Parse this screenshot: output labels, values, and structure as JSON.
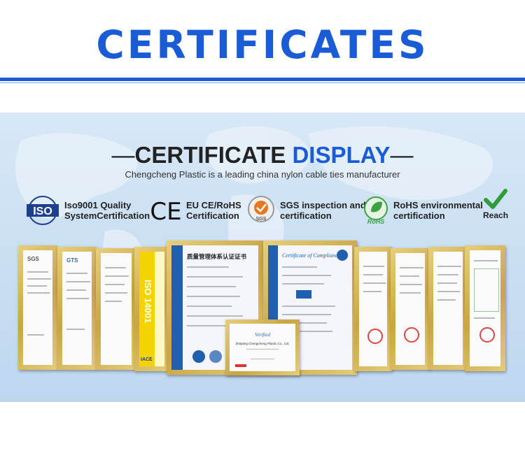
{
  "header": {
    "title": "CERTIFICATES"
  },
  "display": {
    "heading_left_dash": "—",
    "heading_main": "CERTIFICATE",
    "heading_accent": "DISPLAY",
    "heading_right_dash": "—",
    "subheading": "Chengcheng Plastic is a leading china nylon cable ties manufacturer"
  },
  "badges": [
    {
      "icon": "iso-logo-icon",
      "icon_text": "ISO",
      "line1": "Iso9001 Quality",
      "line2": "SystemCertification"
    },
    {
      "icon": "ce-mark-icon",
      "icon_text": "CE",
      "line1": "EU CE/RoHS",
      "line2": "Certification"
    },
    {
      "icon": "sgs-logo-icon",
      "icon_text": "SGS",
      "line1": "SGS inspection and",
      "line2": "certification"
    },
    {
      "icon": "rohs-logo-icon",
      "icon_text": "RoHS",
      "line1": "RoHS environmental",
      "line2": "certification"
    },
    {
      "icon": "reach-check-icon",
      "icon_text": "Reach",
      "line1": "",
      "line2": ""
    }
  ],
  "certificates": {
    "left_1_logo": "SGS",
    "left_2_logo": "GTS",
    "iso14001_text": "ISO 14001",
    "iso14001_brand": "IACE",
    "quality_title": "质量管理体系认证证书",
    "compliance_title": "Certificate of Compliance",
    "verified_title": "Verified",
    "verified_company": "Zhejiang Chengcheng Plastic Co., Ltd."
  },
  "colors": {
    "accent": "#1a5bd6",
    "frame_gold": "#c9a544",
    "panel_bg": "#c9def2"
  }
}
